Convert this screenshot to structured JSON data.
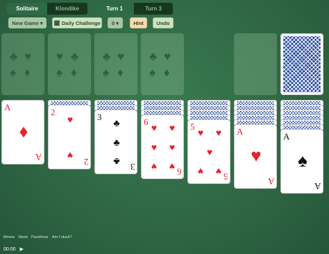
{
  "tabs_game": [
    "Solitaire",
    "Klondike"
  ],
  "tabs_turn": [
    "Turn 1",
    "Turn 3"
  ],
  "toolbar": {
    "new_game": "New Game ▾",
    "daily": "🗓 Daily Challenge",
    "undo_count": "0 ▾",
    "hint": "Hint",
    "undo": "Undo"
  },
  "foundations": {
    "pips": [
      "♣",
      "♥",
      "♠",
      "♦"
    ]
  },
  "tableau": [
    {
      "rank": "A",
      "suit": "♦",
      "color": "red",
      "hidden": 0
    },
    {
      "rank": "2",
      "suit": "♥",
      "color": "red",
      "hidden": 1
    },
    {
      "rank": "3",
      "suit": "♣",
      "color": "black",
      "hidden": 2
    },
    {
      "rank": "6",
      "suit": "♥",
      "color": "red",
      "hidden": 3
    },
    {
      "rank": "5",
      "suit": "♥",
      "color": "red",
      "hidden": 4
    },
    {
      "rank": "A",
      "suit": "♥",
      "color": "red",
      "hidden": 5
    },
    {
      "rank": "A",
      "suit": "♠",
      "color": "black",
      "hidden": 6
    }
  ],
  "status": {
    "labels": [
      "Moves",
      "Stock",
      "Passthrus"
    ],
    "stuck": "Am I stuck?",
    "time": "00:00",
    "play_icon": "play-icon"
  },
  "colors": {
    "felt": "#2f6b45",
    "red": "#e4232b",
    "card_back": "#2a4fa3"
  }
}
